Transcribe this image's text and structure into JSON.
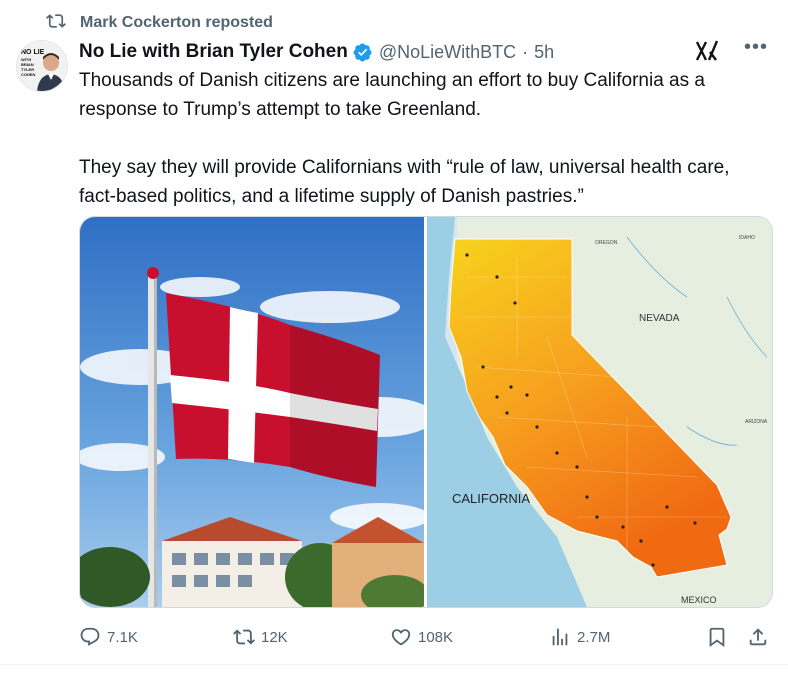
{
  "repost_banner": {
    "text": "Mark Cockerton reposted"
  },
  "author": {
    "name": "No Lie with Brian Tyler Cohen",
    "handle": "@NoLieWithBTC",
    "separator": "·",
    "time": "5h",
    "avatar_text_lines": [
      "NO LIE",
      "WITH",
      "BRIAN",
      "TYLER",
      "COHEN"
    ]
  },
  "tweet": {
    "paragraphs": [
      "Thousands of Danish citizens are launching an effort to buy California as a response to Trump’s attempt to take Greenland.",
      "They say they will provide Californians with “rule of law, universal health care, fact-based politics, and a lifetime supply of Danish pastries.”"
    ]
  },
  "media": {
    "left_image": "danish-flag-on-pole",
    "right_image": "california-map",
    "map_labels": {
      "oregon": "OREGON",
      "idaho": "IDAHO",
      "nevada": "NEVADA",
      "california": "CALIFORNIA",
      "arizona": "ARIZONA",
      "mexico": "MEXICO"
    }
  },
  "actions": {
    "replies": "7.1K",
    "reposts": "12K",
    "likes": "108K",
    "views": "2.7M"
  },
  "colors": {
    "text": "#0f1419",
    "muted": "#536471",
    "verified": "#1d9bf0",
    "flag_red": "#c8102e"
  }
}
